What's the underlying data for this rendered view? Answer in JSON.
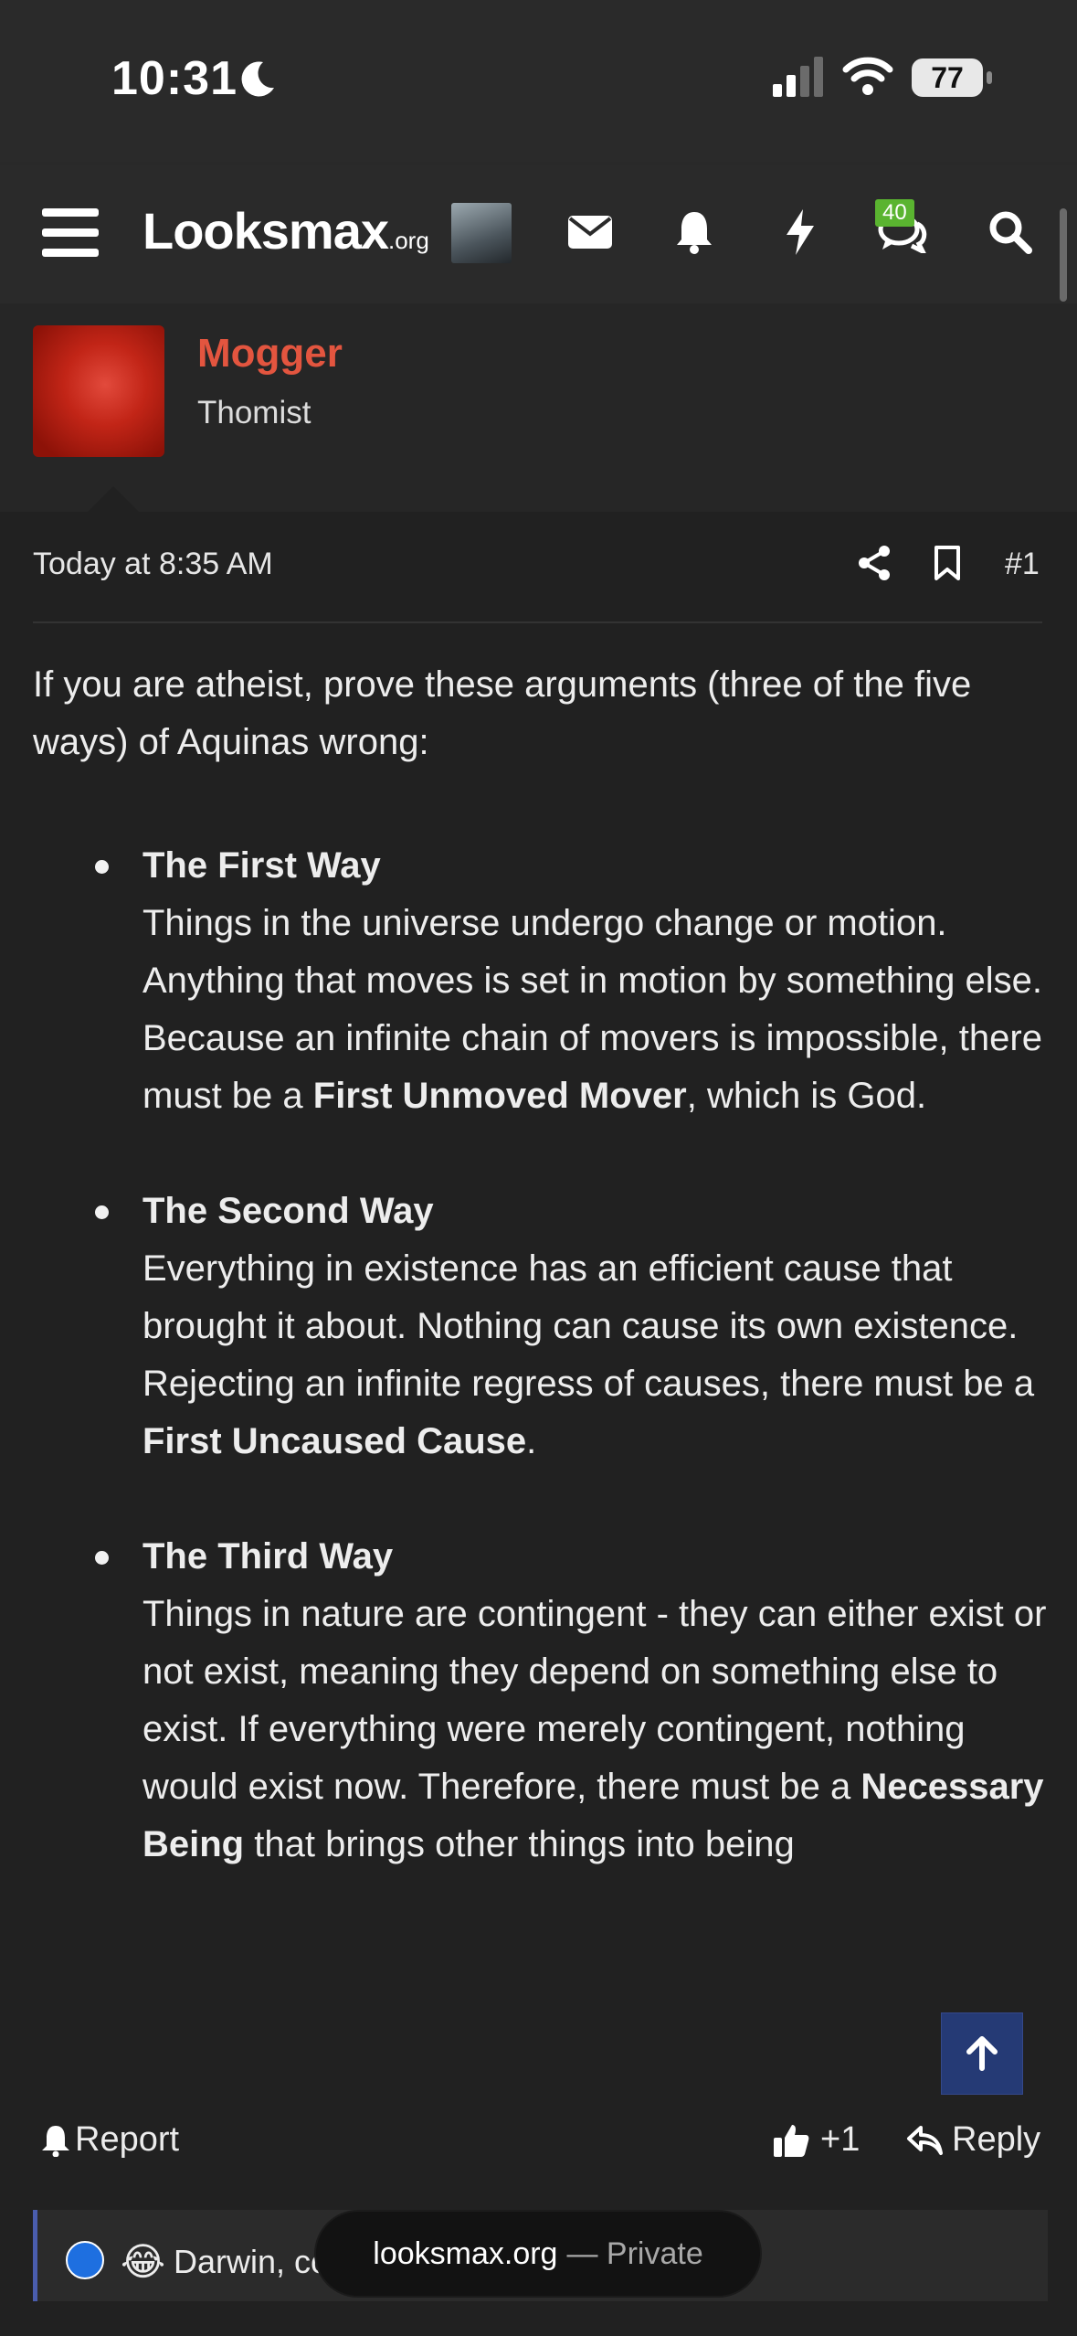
{
  "status_bar": {
    "time": "10:31",
    "battery": "77"
  },
  "nav": {
    "logo_main": "Looksmax",
    "logo_suffix": ".org",
    "conversations_badge": "40"
  },
  "author": {
    "name": "Mogger",
    "title": "Thomist"
  },
  "post": {
    "timestamp": "Today at 8:35 AM",
    "number": "#1",
    "intro": "If you are atheist, prove these arguments (three of the five ways) of Aquinas wrong:",
    "ways": [
      {
        "title": "The First Way",
        "text_before": "Things in the universe undergo change or motion. Anything that moves is set in motion by something else. Because an infinite chain of movers is impossible, there must be a ",
        "bold": "First Unmoved Mover",
        "text_after": ", which is God."
      },
      {
        "title": "The Second Way",
        "text_before": "Everything in existence has an efficient cause that brought it about. Nothing can cause its own existence. Rejecting an infinite regress of causes, there must be a ",
        "bold": "First Uncaused Cause",
        "text_after": "."
      },
      {
        "title": "The Third Way",
        "text_before": "Things in nature are contingent - they can either exist or not exist, meaning they depend on something else to exist. If everything were merely contingent, nothing would exist now. Therefore, there must be a ",
        "bold": "Necessary Being",
        "text_after": " that brings other things into being"
      }
    ]
  },
  "actions": {
    "report": "Report",
    "like_count": "+1",
    "reply": "Reply"
  },
  "reactions": {
    "text": "Darwin, co"
  },
  "browser": {
    "domain": "looksmax.org",
    "mode": "— Private"
  },
  "colors": {
    "accent_name": "#e3553f",
    "scroll_top_bg": "#253a75",
    "badge": "#5ab430"
  },
  "icons": [
    "moon-icon",
    "signal-icon",
    "wifi-icon",
    "menu-icon",
    "envelope-icon",
    "bell-icon",
    "bolt-icon",
    "chat-icon",
    "search-icon",
    "share-icon",
    "bookmark-icon",
    "arrow-up-icon",
    "bell-small-icon",
    "thumbs-up-icon",
    "reply-icon"
  ]
}
